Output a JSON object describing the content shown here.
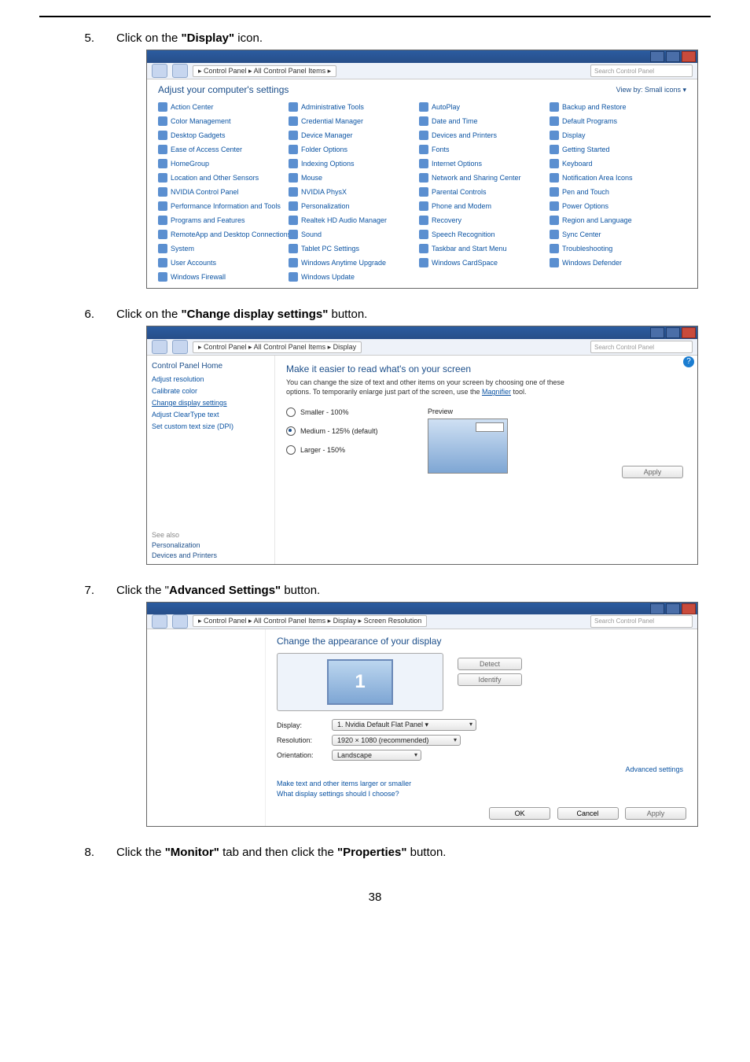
{
  "page_number": "38",
  "steps": {
    "s5": {
      "num": "5.",
      "prefix": "Click on the ",
      "bold": "\"Display\"",
      "suffix": " icon."
    },
    "s6": {
      "num": "6.",
      "prefix": "Click on the ",
      "bold": "\"Change display settings\"",
      "suffix": " button."
    },
    "s7": {
      "num": "7.",
      "prefix": "Click the \"",
      "bold": "Advanced Settings\"",
      "suffix": " button."
    },
    "s8": {
      "num": "8.",
      "prefix": "Click the ",
      "bold1": "\"Monitor\"",
      "mid": " tab and then click the ",
      "bold2": "\"Properties\"",
      "suffix": " button."
    }
  },
  "shot1": {
    "breadcrumb": "▸ Control Panel ▸ All Control Panel Items ▸",
    "search_ph": "Search Control Panel",
    "heading": "Adjust your computer's settings",
    "viewby": "View by:   Small icons ▾",
    "cols": [
      [
        "Action Center",
        "Color Management",
        "Desktop Gadgets",
        "Ease of Access Center",
        "HomeGroup",
        "Location and Other Sensors",
        "NVIDIA Control Panel",
        "Performance Information and Tools",
        "Programs and Features",
        "RemoteApp and Desktop Connections",
        "System",
        "User Accounts",
        "Windows Firewall"
      ],
      [
        "Administrative Tools",
        "Credential Manager",
        "Device Manager",
        "Folder Options",
        "Indexing Options",
        "Mouse",
        "NVIDIA PhysX",
        "Personalization",
        "Realtek HD Audio Manager",
        "Sound",
        "Tablet PC Settings",
        "Windows Anytime Upgrade",
        "Windows Update"
      ],
      [
        "AutoPlay",
        "Date and Time",
        "Devices and Printers",
        "Fonts",
        "Internet Options",
        "Network and Sharing Center",
        "Parental Controls",
        "Phone and Modem",
        "Recovery",
        "Speech Recognition",
        "Taskbar and Start Menu",
        "Windows CardSpace",
        ""
      ],
      [
        "Backup and Restore",
        "Default Programs",
        "Display",
        "Getting Started",
        "Keyboard",
        "Notification Area Icons",
        "Pen and Touch",
        "Power Options",
        "Region and Language",
        "Sync Center",
        "Troubleshooting",
        "Windows Defender",
        ""
      ]
    ]
  },
  "shot2": {
    "breadcrumb": "▸ Control Panel ▸ All Control Panel Items ▸ Display",
    "search_ph": "Search Control Panel",
    "side": {
      "home": "Control Panel Home",
      "links": [
        "Adjust resolution",
        "Calibrate color",
        "Change display settings",
        "Adjust ClearType text",
        "Set custom text size (DPI)"
      ],
      "seealso": "See also",
      "bottom": [
        "Personalization",
        "Devices and Printers"
      ]
    },
    "h1": "Make it easier to read what's on your screen",
    "desc_a": "You can change the size of text and other items on your screen by choosing one of these options. To temporarily enlarge just part of the screen, use the ",
    "desc_link": "Magnifier",
    "desc_b": " tool.",
    "radios": {
      "r1": "Smaller - 100%",
      "r2": "Medium - 125% (default)",
      "r3": "Larger - 150%"
    },
    "preview_lbl": "Preview",
    "apply": "Apply"
  },
  "shot3": {
    "breadcrumb": "▸ Control Panel ▸ All Control Panel Items ▸ Display ▸ Screen Resolution",
    "search_ph": "Search Control Panel",
    "h1": "Change the appearance of your display",
    "detect": "Detect",
    "identify": "Identify",
    "mon_num": "1",
    "form": {
      "display_lbl": "Display:",
      "display_val": "1. Nvidia Default Flat Panel ▾",
      "res_lbl": "Resolution:",
      "res_val": "1920 × 1080 (recommended)",
      "orient_lbl": "Orientation:",
      "orient_val": "Landscape"
    },
    "adv": "Advanced settings",
    "extras": [
      "Make text and other items larger or smaller",
      "What display settings should I choose?"
    ],
    "ok": "OK",
    "cancel": "Cancel",
    "apply": "Apply"
  }
}
